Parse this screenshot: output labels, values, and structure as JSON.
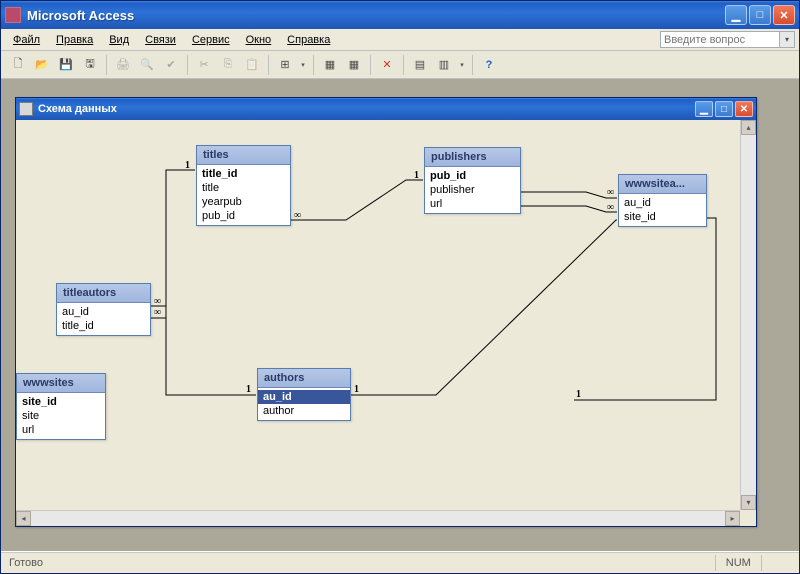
{
  "app": {
    "title": "Microsoft Access"
  },
  "menubar": {
    "items": [
      "Файл",
      "Правка",
      "Вид",
      "Связи",
      "Сервис",
      "Окно",
      "Справка"
    ]
  },
  "question": {
    "placeholder": "Введите вопрос"
  },
  "toolbar": {
    "icons": [
      "new",
      "open",
      "save",
      "saveall",
      "sep",
      "print",
      "preview",
      "spell",
      "sep",
      "cut",
      "copy",
      "paste",
      "sep",
      "addtable",
      "sep",
      "relations1",
      "relations2",
      "sep",
      "delete",
      "sep",
      "properties",
      "options",
      "sep",
      "help"
    ]
  },
  "child": {
    "title": "Схема данных"
  },
  "tables": {
    "titleautors": {
      "title": "titleautors",
      "fields": [
        {
          "name": "au_id",
          "key": false
        },
        {
          "name": "title_id",
          "key": false
        }
      ]
    },
    "titles": {
      "title": "titles",
      "fields": [
        {
          "name": "title_id",
          "key": true
        },
        {
          "name": "title",
          "key": false
        },
        {
          "name": "yearpub",
          "key": false
        },
        {
          "name": "pub_id",
          "key": false
        }
      ]
    },
    "publishers": {
      "title": "publishers",
      "fields": [
        {
          "name": "pub_id",
          "key": true
        },
        {
          "name": "publisher",
          "key": false
        },
        {
          "name": "url",
          "key": false
        }
      ]
    },
    "wwwsitea": {
      "title": "wwwsitea...",
      "fields": [
        {
          "name": "au_id",
          "key": false
        },
        {
          "name": "site_id",
          "key": false
        }
      ]
    },
    "authors": {
      "title": "authors",
      "fields": [
        {
          "name": "au_id",
          "key": true,
          "selected": true
        },
        {
          "name": "author",
          "key": false
        }
      ]
    },
    "wwwsites": {
      "title": "wwwsites",
      "fields": [
        {
          "name": "site_id",
          "key": true
        },
        {
          "name": "site",
          "key": false
        },
        {
          "name": "url",
          "key": false
        }
      ]
    }
  },
  "status": {
    "ready": "Готово",
    "num": "NUM"
  },
  "cardinality": {
    "one": "1",
    "many": "∞"
  }
}
